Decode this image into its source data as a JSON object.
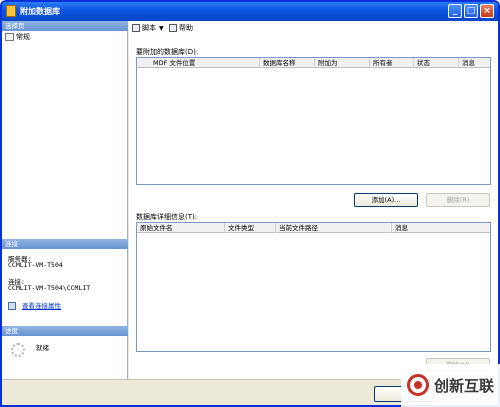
{
  "window": {
    "title": "附加数据库"
  },
  "left_panel": {
    "page_section": {
      "header": "选择页",
      "items": [
        {
          "label": "常规"
        }
      ]
    },
    "connection_section": {
      "header": "连接",
      "server_label": "服务器:",
      "server_value": "CCMLIT-VM-T504",
      "conn_label": "连接:",
      "conn_value": "CCMLIT-VM-T504\\CCMLIT",
      "view_props_link": "查看连接属性"
    },
    "progress_section": {
      "header": "进度",
      "status": "就绪"
    }
  },
  "toolbar": {
    "script_label": "脚本",
    "help_label": "帮助"
  },
  "attach_group": {
    "label": "要附加的数据库(D):",
    "columns": [
      "MDF 文件位置",
      "数据库名称",
      "附加为",
      "所有者",
      "状态",
      "消息"
    ],
    "add_button": "添加(A)...",
    "remove_button": "删除(R)"
  },
  "details_group": {
    "label": "数据库详细信息(T):",
    "columns": [
      "原始文件名",
      "文件类型",
      "当前文件路径",
      "消息"
    ],
    "remove_button": "删除(M)"
  },
  "watermark": {
    "text": "创新互联",
    "accent": "#c7332b"
  }
}
